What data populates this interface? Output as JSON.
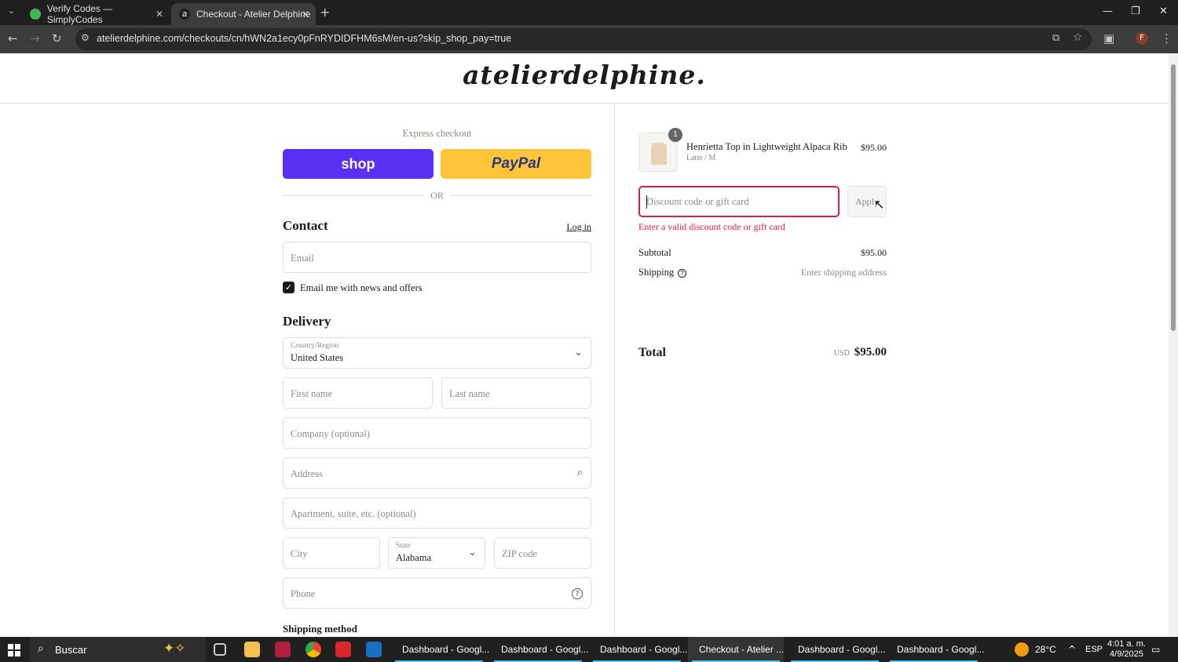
{
  "browser": {
    "tabs": [
      {
        "title": "Verify Codes — SimplyCodes",
        "active": false
      },
      {
        "title": "Checkout - Atelier Delphine",
        "active": true
      }
    ],
    "url": "atelierdelphine.com/checkouts/cn/hWN2a1ecy0pFnRYDIDFHM6sM/en-us?skip_shop_pay=true"
  },
  "page": {
    "logo": "atelierdelphine.",
    "express_checkout": "Express checkout",
    "shop_pay_label": "shop",
    "paypal_label": "PayPal",
    "or": "OR",
    "contact": {
      "title": "Contact",
      "login": "Log in",
      "email_placeholder": "Email",
      "newsletter_label": "Email me with news and offers",
      "newsletter_checked": true
    },
    "delivery": {
      "title": "Delivery",
      "country_label": "Country/Region",
      "country_value": "United States",
      "first_name": "First name",
      "last_name": "Last name",
      "company": "Company (optional)",
      "address": "Address",
      "apartment": "Apartment, suite, etc. (optional)",
      "city": "City",
      "state_label": "State",
      "state_value": "Alabama",
      "zip": "ZIP code",
      "phone": "Phone"
    },
    "shipping_method_title": "Shipping method"
  },
  "summary": {
    "item": {
      "quantity": "1",
      "name": "Henrietta Top in Lightweight Alpaca Rib",
      "variant": "Latte / M",
      "price": "$95.00"
    },
    "discount_placeholder": "Discount code or gift card",
    "apply_label": "Apply",
    "error": "Enter a valid discount code or gift card",
    "subtotal_label": "Subtotal",
    "subtotal_value": "$95.00",
    "shipping_label": "Shipping",
    "shipping_value": "Enter shipping address",
    "total_label": "Total",
    "total_currency": "USD",
    "total_value": "$95.00"
  },
  "taskbar": {
    "search": "Buscar",
    "apps": [
      {
        "label": "Dashboard - Googl..."
      },
      {
        "label": "Dashboard - Googl..."
      },
      {
        "label": "Dashboard - Googl..."
      },
      {
        "label": "Checkout - Atelier ..."
      },
      {
        "label": "Dashboard - Googl..."
      },
      {
        "label": "Dashboard - Googl..."
      }
    ],
    "weather": "28°C",
    "lang": "ESP",
    "time": "4:01 a. m.",
    "date": "4/9/2025"
  }
}
